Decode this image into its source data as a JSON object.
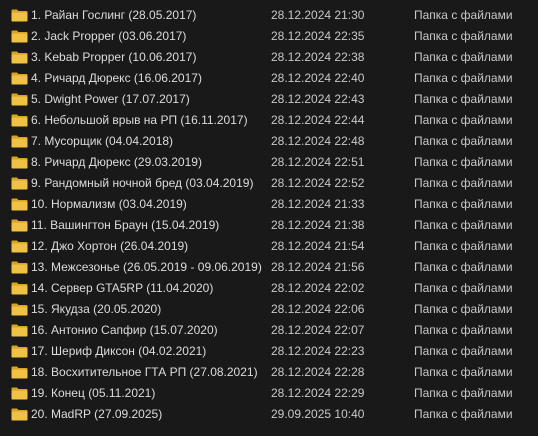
{
  "icons": {
    "folder": "folder-icon"
  },
  "colors": {
    "background": "#191919",
    "text": "#dcdcdc",
    "folder_body": "#f0c244",
    "folder_back": "#d9a322"
  },
  "files": [
    {
      "name": "1. Райан Гослинг (28.05.2017)",
      "date": "28.12.2024 21:30",
      "type": "Папка с файлами"
    },
    {
      "name": "2. Jack Propper (03.06.2017)",
      "date": "28.12.2024 22:35",
      "type": "Папка с файлами"
    },
    {
      "name": "3. Kebab Propper (10.06.2017)",
      "date": "28.12.2024 22:38",
      "type": "Папка с файлами"
    },
    {
      "name": "4. Ричард Дюрекс (16.06.2017)",
      "date": "28.12.2024 22:40",
      "type": "Папка с файлами"
    },
    {
      "name": "5. Dwight Power (17.07.2017)",
      "date": "28.12.2024 22:43",
      "type": "Папка с файлами"
    },
    {
      "name": "6. Небольшой врыв на РП (16.11.2017)",
      "date": "28.12.2024 22:44",
      "type": "Папка с файлами"
    },
    {
      "name": "7. Мусорщик (04.04.2018)",
      "date": "28.12.2024 22:48",
      "type": "Папка с файлами"
    },
    {
      "name": "8. Ричард Дюрекс (29.03.2019)",
      "date": "28.12.2024 22:51",
      "type": "Папка с файлами"
    },
    {
      "name": "9. Рандомный ночной бред (03.04.2019)",
      "date": "28.12.2024 22:52",
      "type": "Папка с файлами"
    },
    {
      "name": "10. Нормализм (03.04.2019)",
      "date": "28.12.2024 21:33",
      "type": "Папка с файлами"
    },
    {
      "name": "11. Вашингтон Браун (15.04.2019)",
      "date": "28.12.2024 21:38",
      "type": "Папка с файлами"
    },
    {
      "name": "12. Джо Хортон (26.04.2019)",
      "date": "28.12.2024 21:54",
      "type": "Папка с файлами"
    },
    {
      "name": "13. Межсезонье (26.05.2019 - 09.06.2019)",
      "date": "28.12.2024 21:56",
      "type": "Папка с файлами"
    },
    {
      "name": "14. Сервер GTA5RP (11.04.2020)",
      "date": "28.12.2024 22:02",
      "type": "Папка с файлами"
    },
    {
      "name": "15. Якудза (20.05.2020)",
      "date": "28.12.2024 22:06",
      "type": "Папка с файлами"
    },
    {
      "name": "16. Антонио Сапфир (15.07.2020)",
      "date": "28.12.2024 22:07",
      "type": "Папка с файлами"
    },
    {
      "name": "17. Шериф Диксон (04.02.2021)",
      "date": "28.12.2024 22:23",
      "type": "Папка с файлами"
    },
    {
      "name": "18. Восхитительное ГТА РП (27.08.2021)",
      "date": "28.12.2024 22:28",
      "type": "Папка с файлами"
    },
    {
      "name": "19. Конец (05.11.2021)",
      "date": "28.12.2024 22:29",
      "type": "Папка с файлами"
    },
    {
      "name": "20. MadRP (27.09.2025)",
      "date": "29.09.2025 10:40",
      "type": "Папка с файлами"
    }
  ]
}
